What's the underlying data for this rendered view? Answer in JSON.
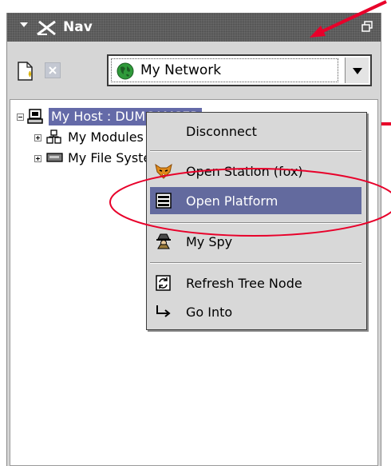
{
  "panel": {
    "title": "Nav",
    "title_icon": "nav-icon",
    "restore_icon": "restore-window-icon",
    "header_color": "#5e5e5e"
  },
  "toolbar": {
    "new_icon": "new-document-icon",
    "close_icon": "close-icon",
    "network_select": {
      "value": "My Network",
      "icon": "globe-icon"
    }
  },
  "tree": {
    "host": {
      "label": "My Host : DUMCAMSER",
      "icon": "computer-icon",
      "expanded": true
    },
    "children": [
      {
        "label": "My Modules",
        "icon": "modules-icon"
      },
      {
        "label": "My File System",
        "icon": "drive-icon"
      }
    ]
  },
  "context_menu": {
    "items": [
      {
        "label": "Disconnect",
        "icon": ""
      },
      {
        "label": "Open Station (fox)",
        "icon": "fox-icon"
      },
      {
        "label": "Open Platform",
        "icon": "platform-icon",
        "selected": true
      },
      {
        "label": "My Spy",
        "icon": "spy-icon"
      },
      {
        "label": "Refresh Tree Node",
        "icon": "refresh-icon"
      },
      {
        "label": "Go Into",
        "icon": "go-into-icon"
      }
    ],
    "selected_color": "#636a9e"
  },
  "annotations": {
    "color": "#e8002a"
  }
}
